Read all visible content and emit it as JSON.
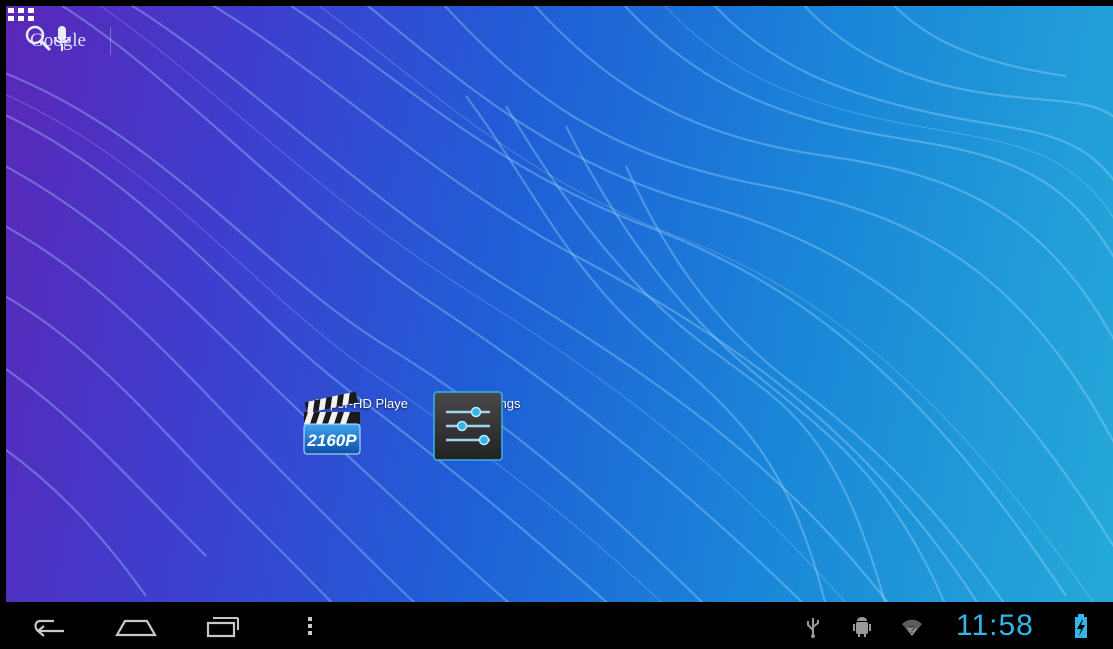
{
  "search": {
    "provider_label": "Google",
    "icon": "search-icon",
    "voice_icon": "mic-icon"
  },
  "apps_button": {
    "icon": "all-apps-grid-icon"
  },
  "shortcuts": [
    {
      "label": "Super-HD Playe",
      "icon": "video-player-icon",
      "badge_text": "2160P"
    },
    {
      "label": "Settings",
      "icon": "settings-sliders-icon"
    }
  ],
  "navbar": {
    "back_icon": "back-icon",
    "home_icon": "home-icon",
    "recents_icon": "recent-apps-icon",
    "menu_icon": "overflow-menu-icon"
  },
  "status": {
    "time": "11:58",
    "usb_icon": "usb-icon",
    "debug_icon": "android-debug-icon",
    "wifi_icon": "wifi-icon",
    "battery_icon": "battery-charging-icon",
    "accent_color": "#33b5e5"
  }
}
